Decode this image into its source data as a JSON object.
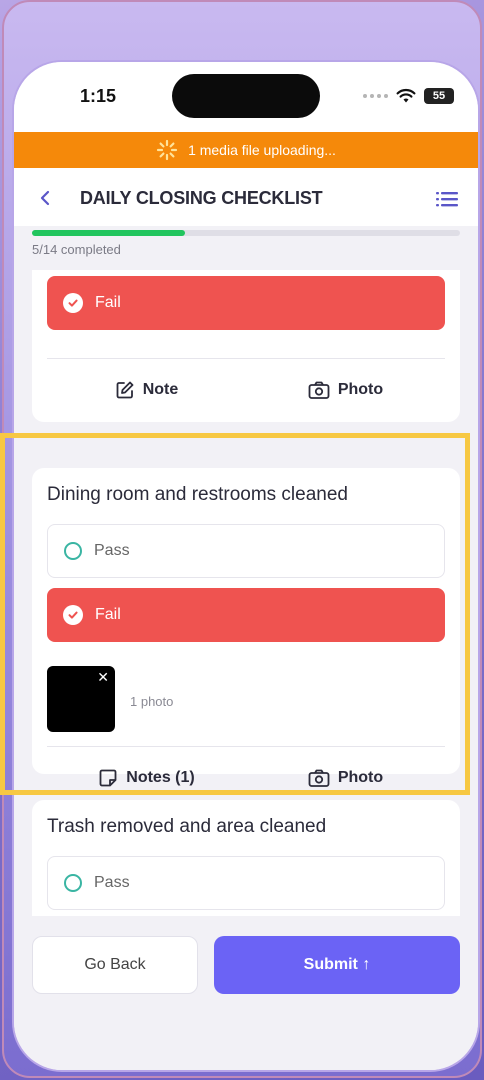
{
  "status": {
    "time": "1:15",
    "battery": "55"
  },
  "upload_banner": {
    "text": "1 media file uploading..."
  },
  "header": {
    "title": "DAILY CLOSING CHECKLIST"
  },
  "progress": {
    "text": "5/14 completed",
    "fraction": 0.357
  },
  "items": [
    {
      "fail_label": "Fail",
      "note_label": "Note",
      "photo_label": "Photo"
    },
    {
      "title": "Dining room and restrooms cleaned",
      "pass_label": "Pass",
      "fail_label": "Fail",
      "photo_count": "1 photo",
      "notes_label": "Notes (1)",
      "photo_label": "Photo"
    },
    {
      "title": "Trash removed and area cleaned",
      "pass_label": "Pass"
    }
  ],
  "footer": {
    "back_label": "Go Back",
    "submit_label": "Submit ↑"
  },
  "colors": {
    "banner": "#f5890a",
    "fail": "#ef5350",
    "progress": "#22c55e",
    "submit": "#6b63f5",
    "highlight": "#f7c843",
    "radio": "#3ab5a3"
  }
}
